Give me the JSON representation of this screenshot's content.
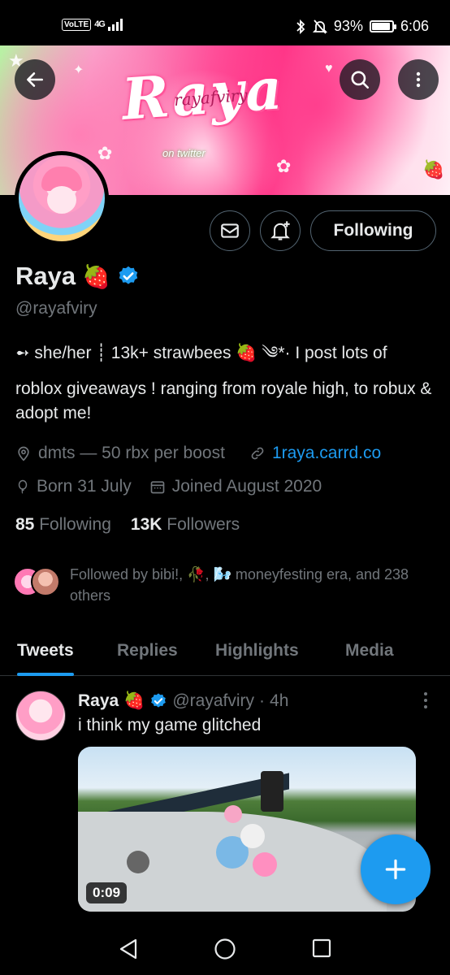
{
  "status_bar": {
    "carrier_badge": "VoLTE",
    "network": "4G",
    "battery": "93%",
    "battery_level": 0.93,
    "time": "6:06"
  },
  "banner": {
    "title_art": "Raya",
    "subtitle_art": "rayafviry",
    "tagline_art": "on twitter"
  },
  "icons": {
    "back": "back-arrow-icon",
    "search": "search-icon",
    "more": "more-vertical-icon",
    "message": "mail-icon",
    "notify": "bell-plus-icon",
    "verified": "verified-badge-icon",
    "location": "location-icon",
    "link": "link-icon",
    "birthday": "balloon-icon",
    "joined": "calendar-icon",
    "compose": "plus-icon"
  },
  "profile": {
    "display_name": "Raya",
    "name_emoji": "🍓",
    "handle": "@rayafviry",
    "follow_button": "Following",
    "bio_line1": "➻ she/her ┊ 13k+ strawbees 🍓 ༄*· I post lots of",
    "bio_line2": "roblox giveaways ! ranging from royale high, to robux & adopt me!",
    "location": "dmts — 50 rbx per boost",
    "website": "1raya.carrd.co",
    "birthday": "Born 31 July",
    "joined": "Joined August 2020",
    "following_count": "85",
    "following_label": "Following",
    "followers_count": "13K",
    "followers_label": "Followers",
    "followed_by": "Followed by bibi!, 🥀, 🌬️ moneyfesting era, and 238 others"
  },
  "tabs": [
    {
      "label": "Tweets",
      "active": true
    },
    {
      "label": "Replies",
      "active": false
    },
    {
      "label": "Highlights",
      "active": false
    },
    {
      "label": "Media",
      "active": false
    }
  ],
  "tweet": {
    "name": "Raya",
    "emoji": "🍓",
    "handle": "@rayafviry",
    "separator": "·",
    "time": "4h",
    "text": "i think my game glitched",
    "video_duration": "0:09"
  },
  "colors": {
    "accent": "#1d9bf0",
    "secondary_text": "#71767b",
    "primary_text": "#e7e9ea",
    "border": "#2f3336",
    "background": "#000000"
  }
}
